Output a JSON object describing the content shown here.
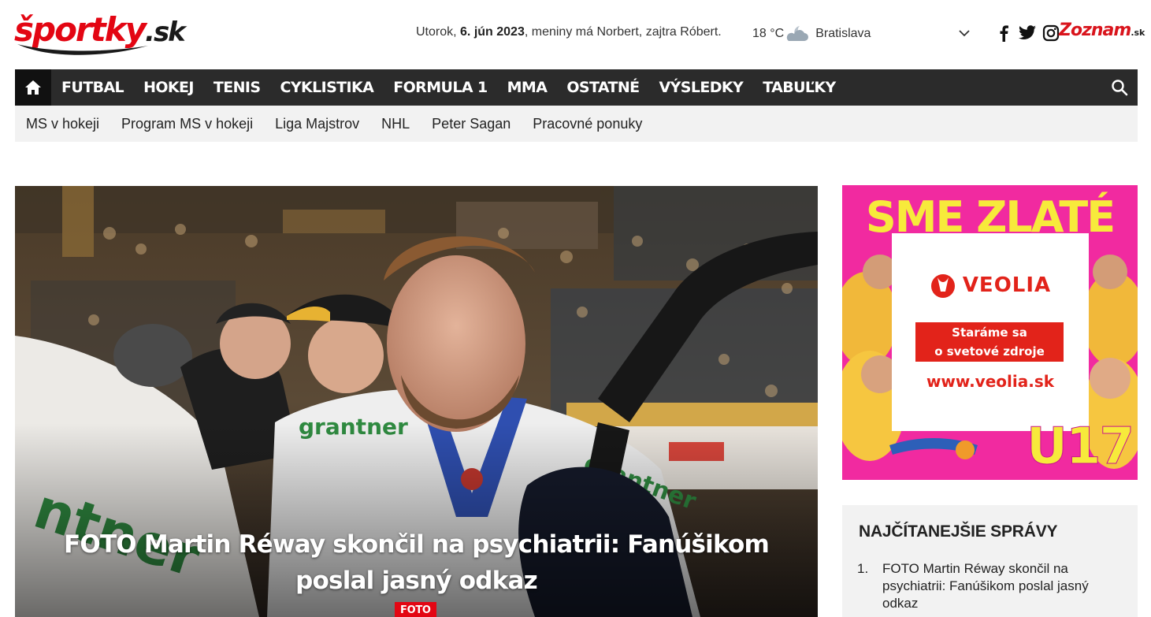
{
  "header": {
    "logo": {
      "main": "športky",
      "suffix": ".sk"
    },
    "date": {
      "day": "Utorok,",
      "date": "6. jún 2023",
      "nameday": ", meniny má Norbert, zajtra Róbert."
    },
    "weather": {
      "temp": "18 °C",
      "icon": "partly-cloudy-night-icon",
      "city": "Bratislava"
    },
    "social": [
      "facebook-icon",
      "twitter-icon",
      "instagram-icon"
    ],
    "partner_logo": {
      "text": "Zoznam",
      "suffix": ".sk"
    }
  },
  "main_nav": {
    "home_icon": "home-icon",
    "items": [
      "FUTBAL",
      "HOKEJ",
      "TENIS",
      "CYKLISTIKA",
      "FORMULA 1",
      "MMA",
      "OSTATNÉ",
      "VÝSLEDKY",
      "TABUĽKY"
    ],
    "search_icon": "search-icon"
  },
  "sub_nav": {
    "items": [
      "MS v hokeji",
      "Program MS v hokeji",
      "Liga Majstrov",
      "NHL",
      "Peter Sagan",
      "Pracovné ponuky"
    ]
  },
  "hero": {
    "title": "FOTO Martin Réway skončil na psychiatrii: Fanúšikom poslal jasný odkaz",
    "tag": "FOTO"
  },
  "ad": {
    "headline": "SME ZLATÉ",
    "brand": "VEOLIA",
    "slogan_line1": "Staráme sa",
    "slogan_line2": "o svetové zdroje",
    "url": "www.veolia.sk",
    "badge": "U17"
  },
  "most_read": {
    "title": "NAJČÍTANEJŠIE SPRÁVY",
    "items": [
      {
        "num": "1.",
        "text": "FOTO Martin Réway skončil na psychiatrii: Fanúšikom poslal jasný odkaz"
      }
    ]
  },
  "colors": {
    "brand_red": "#e30613",
    "nav_bg": "#2b2b2b",
    "subnav_bg": "#f2f2f2",
    "ad_pink": "#f12aa0",
    "ad_yellow": "#f7ea3b",
    "veolia_red": "#e2231a"
  }
}
